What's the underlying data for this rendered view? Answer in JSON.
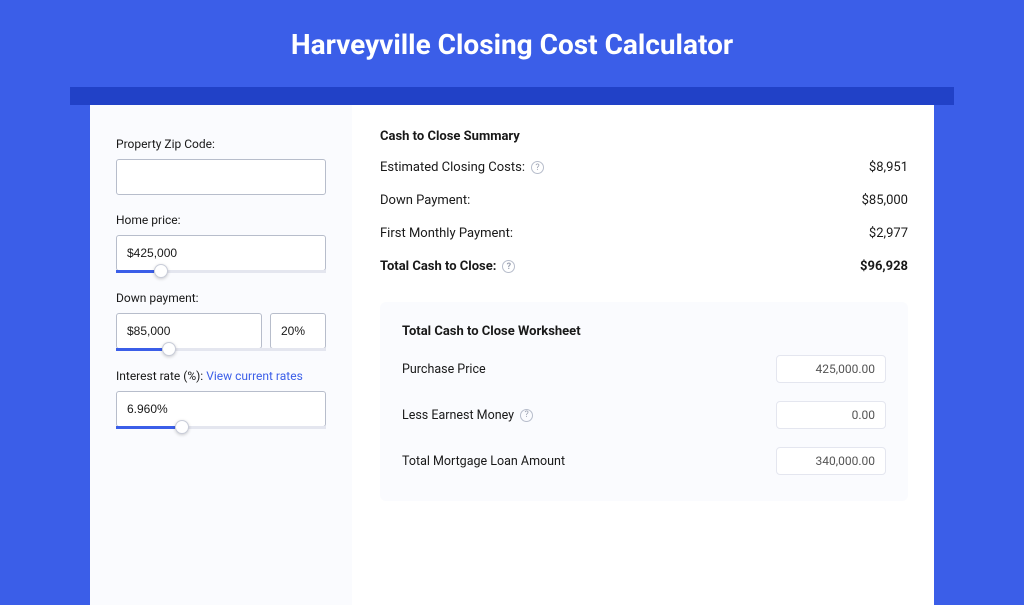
{
  "header": {
    "title": "Harveyville Closing Cost Calculator"
  },
  "form": {
    "zip_label": "Property Zip Code:",
    "zip_value": "",
    "home_price_label": "Home price:",
    "home_price_value": "$425,000",
    "down_payment_label": "Down payment:",
    "down_payment_value": "$85,000",
    "down_payment_pct": "20%",
    "interest_label_prefix": "Interest rate (%): ",
    "interest_link": "View current rates",
    "interest_value": "6.960%",
    "sliders": {
      "home_price_pct": 18,
      "down_payment_pct": 22,
      "interest_pct": 28
    }
  },
  "summary": {
    "heading": "Cash to Close Summary",
    "rows": [
      {
        "label": "Estimated Closing Costs:",
        "value": "$8,951",
        "help": true
      },
      {
        "label": "Down Payment:",
        "value": "$85,000",
        "help": false
      },
      {
        "label": "First Monthly Payment:",
        "value": "$2,977",
        "help": false
      }
    ],
    "total": {
      "label": "Total Cash to Close:",
      "value": "$96,928",
      "help": true
    }
  },
  "worksheet": {
    "heading": "Total Cash to Close Worksheet",
    "rows": [
      {
        "label": "Purchase Price",
        "value": "425,000.00",
        "help": false
      },
      {
        "label": "Less Earnest Money",
        "value": "0.00",
        "help": true
      },
      {
        "label": "Total Mortgage Loan Amount",
        "value": "340,000.00",
        "help": false
      }
    ]
  }
}
